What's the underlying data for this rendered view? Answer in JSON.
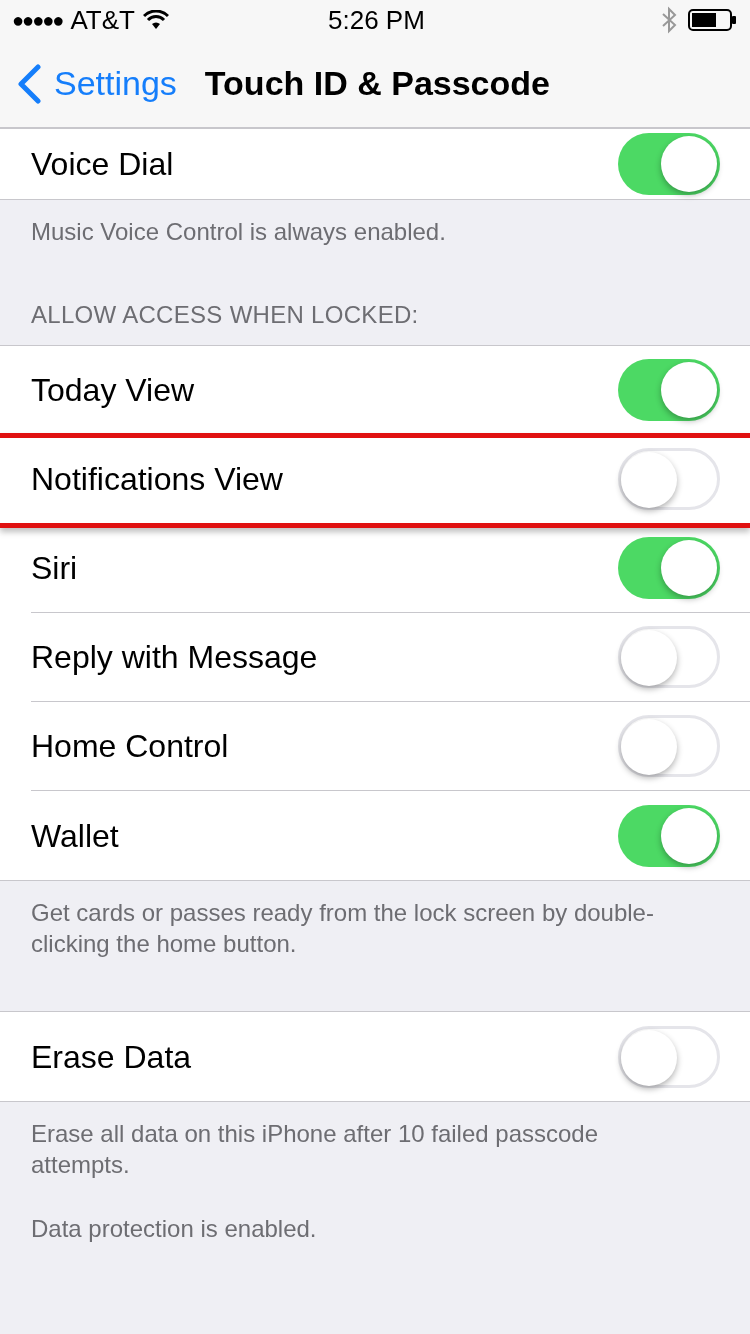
{
  "status_bar": {
    "signal": "●●●●●",
    "carrier": "AT&T",
    "time": "5:26 PM"
  },
  "nav": {
    "back": "Settings",
    "title": "Touch ID & Passcode"
  },
  "sections": [
    {
      "rows": [
        {
          "label": "Voice Dial",
          "on": true,
          "highlighted": false
        }
      ],
      "footer": [
        "Music Voice Control is always enabled."
      ]
    },
    {
      "header": "ALLOW ACCESS WHEN LOCKED:",
      "rows": [
        {
          "label": "Today View",
          "on": true,
          "highlighted": false
        },
        {
          "label": "Notifications View",
          "on": false,
          "highlighted": true
        },
        {
          "label": "Siri",
          "on": true,
          "highlighted": false
        },
        {
          "label": "Reply with Message",
          "on": false,
          "highlighted": false
        },
        {
          "label": "Home Control",
          "on": false,
          "highlighted": false
        },
        {
          "label": "Wallet",
          "on": true,
          "highlighted": false
        }
      ],
      "footer": [
        "Get cards or passes ready from the lock screen by double-clicking the home button."
      ]
    },
    {
      "rows": [
        {
          "label": "Erase Data",
          "on": false,
          "highlighted": false
        }
      ],
      "footer": [
        "Erase all data on this iPhone after 10 failed passcode attempts.",
        "Data protection is enabled."
      ]
    }
  ]
}
